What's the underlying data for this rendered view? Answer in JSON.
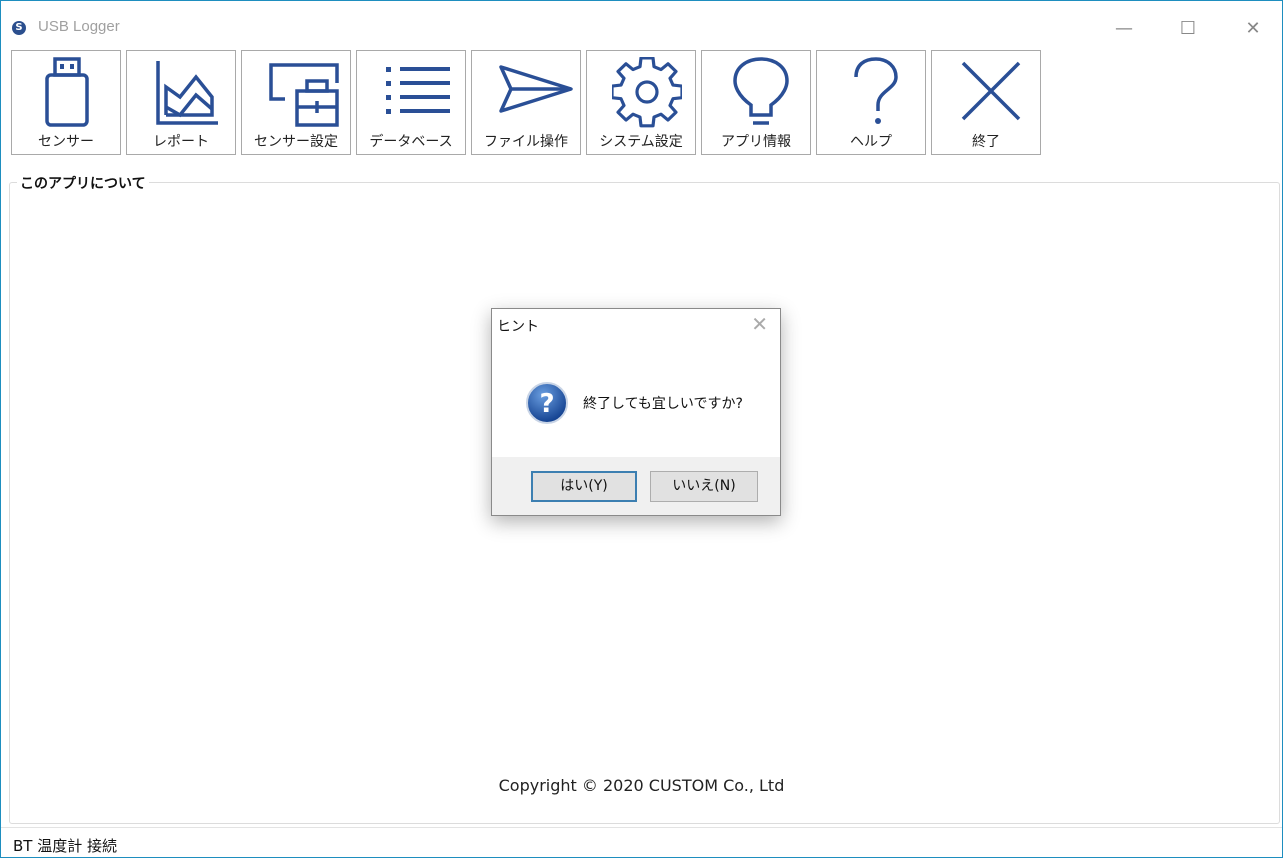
{
  "window": {
    "title": "USB Logger",
    "app_icon_glyph": "S",
    "minimize_glyph": "—",
    "maximize_glyph": "☐",
    "close_glyph": "✕"
  },
  "toolbar": {
    "accent_color": "#2a4f96",
    "buttons": [
      {
        "label": "センサー",
        "icon": "usb-drive-icon"
      },
      {
        "label": "レポート",
        "icon": "area-chart-icon"
      },
      {
        "label": "センサー設定",
        "icon": "window-settings-icon"
      },
      {
        "label": "データベース",
        "icon": "list-icon"
      },
      {
        "label": "ファイル操作",
        "icon": "paper-plane-icon"
      },
      {
        "label": "システム設定",
        "icon": "gear-icon"
      },
      {
        "label": "アプリ情報",
        "icon": "lightbulb-icon"
      },
      {
        "label": "ヘルプ",
        "icon": "question-mark-icon"
      },
      {
        "label": "終了",
        "icon": "close-x-icon"
      }
    ]
  },
  "about": {
    "group_title": "このアプリについて",
    "copyright": "Copyright © 2020 CUSTOM Co., Ltd"
  },
  "status": {
    "text": "BT 温度計 接続"
  },
  "dialog": {
    "title": "ヒント",
    "close_glyph": "✕",
    "icon": "question-icon",
    "icon_glyph": "?",
    "message": "終了しても宜しいですか?",
    "yes_label": "はい(Y)",
    "no_label": "いいえ(N)"
  }
}
